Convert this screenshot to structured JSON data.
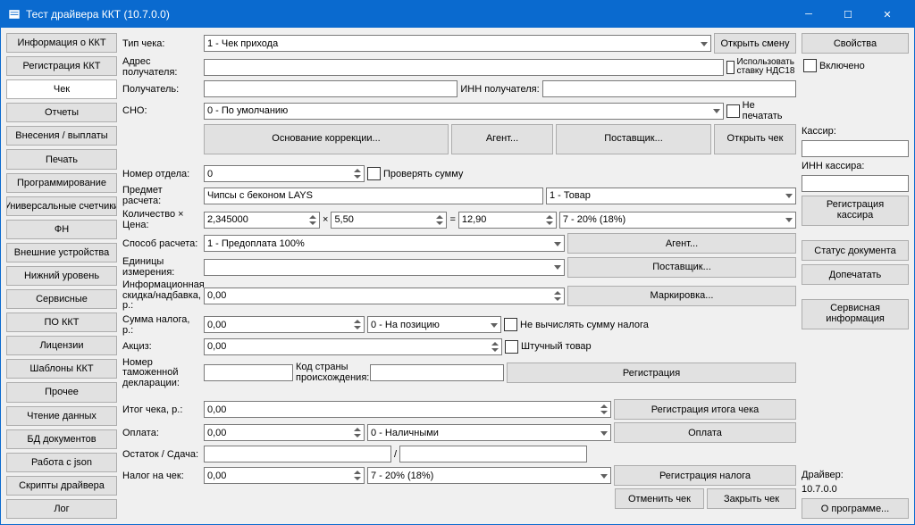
{
  "title": "Тест драйвера ККТ (10.7.0.0)",
  "sidebar": {
    "items": [
      "Информация о ККТ",
      "Регистрация ККТ",
      "Чек",
      "Отчеты",
      "Внесения / выплаты",
      "Печать",
      "Программирование",
      "Универсальные счетчики",
      "ФН",
      "Внешние устройства",
      "Нижний уровень",
      "Сервисные",
      "ПО ККТ",
      "Лицензии",
      "Шаблоны ККТ",
      "Прочее",
      "Чтение данных",
      "БД документов",
      "Работа с json",
      "Скрипты драйвера",
      "Лог"
    ],
    "active_index": 2
  },
  "labels": {
    "check_type": "Тип чека:",
    "recipient_addr": "Адрес получателя:",
    "recipient": "Получатель:",
    "inn_recipient": "ИНН получателя:",
    "sno": "СНО:",
    "open_shift": "Открыть смену",
    "vat_use": "Использовать ставку НДС18",
    "dont_print": "Не печатать",
    "correction_basis": "Основание коррекции...",
    "agent_btn": "Агент...",
    "supplier_btn": "Поставщик...",
    "open_check": "Открыть чек",
    "dept_no": "Номер отдела:",
    "check_sum": "Проверять сумму",
    "subject": "Предмет расчета:",
    "qty_price": "Количество × Цена:",
    "pay_method": "Способ расчета:",
    "units": "Единицы измерения:",
    "info_discount": "Информационная скидка/надбавка, р.:",
    "tax_sum": "Сумма налога, р.:",
    "no_calc_tax": "Не вычислять сумму налога",
    "excise": "Акциз:",
    "piece_good": "Штучный товар",
    "customs_no": "Номер таможенной декларации:",
    "origin_code": "Код страны происхождения:",
    "registration": "Регистрация",
    "marking": "Маркировка...",
    "agent2": "Агент...",
    "supplier2": "Поставщик...",
    "check_total": "Итог чека, р.:",
    "reg_check_total": "Регистрация итога чека",
    "payment": "Оплата:",
    "payment_btn": "Оплата",
    "remainder": "Остаток / Сдача:",
    "tax_on_check": "Налог на чек:",
    "reg_tax": "Регистрация налога",
    "cancel_check": "Отменить чек",
    "close_check": "Закрыть чек",
    "x_sign": "×",
    "eq_sign": "=",
    "slash": "/"
  },
  "values": {
    "check_type": "1 - Чек прихода",
    "recipient_addr": "",
    "recipient": "",
    "inn_recipient": "",
    "sno": "0 - По умолчанию",
    "dept_no": "0",
    "subject": "Чипсы с беконом LAYS",
    "subject_type": "1 - Товар",
    "qty": "2,345000",
    "price": "5,50",
    "total": "12,90",
    "vat_rate": "7 - 20% (18%)",
    "pay_method": "1 - Предоплата 100%",
    "units": "",
    "info_discount": "0,00",
    "tax_sum": "0,00",
    "tax_sum_mode": "0 - На позицию",
    "excise": "0,00",
    "customs_no": "",
    "origin_code": "",
    "check_total": "0,00",
    "payment_amount": "0,00",
    "payment_type": "0 - Наличными",
    "remainder_left": "",
    "remainder_right": "",
    "tax_on_check": "0,00",
    "tax_on_check_rate": "7 - 20% (18%)"
  },
  "right": {
    "properties": "Свойства",
    "enabled": "Включено",
    "cashier": "Кассир:",
    "cashier_val": "",
    "cashier_inn": "ИНН кассира:",
    "cashier_inn_val": "",
    "cashier_reg": "Регистрация кассира",
    "doc_status": "Статус документа",
    "print_more": "Допечатать",
    "service_info": "Сервисная информация",
    "driver_lbl": "Драйвер:",
    "driver_ver": "10.7.0.0",
    "about": "О программе..."
  }
}
